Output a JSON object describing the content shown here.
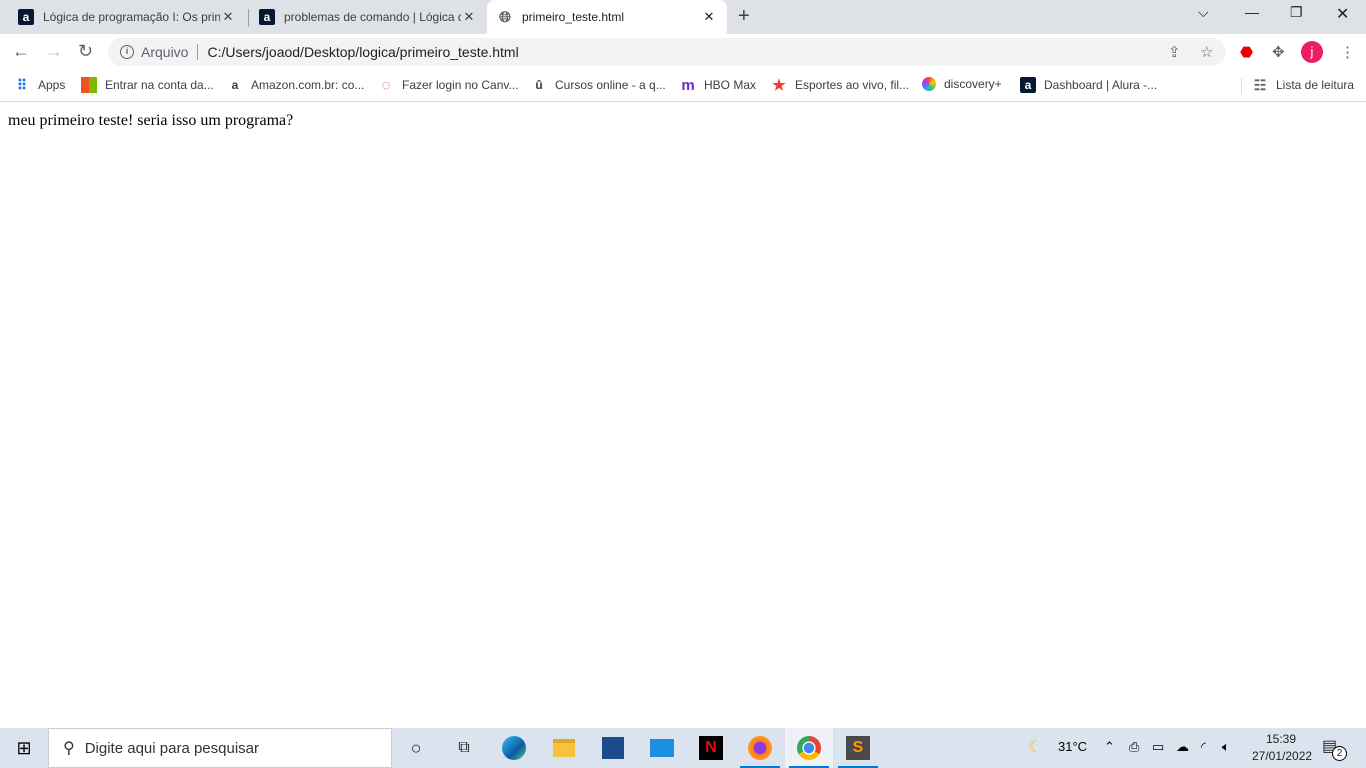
{
  "tabs": [
    {
      "title": "Lógica de programação I: Os prin",
      "favicon": "alura-icon"
    },
    {
      "title": "problemas de comando | Lógica d",
      "favicon": "alura-icon"
    },
    {
      "title": "primeiro_teste.html",
      "favicon": "globe-icon",
      "active": true
    }
  ],
  "address": {
    "scheme": "Arquivo",
    "url": "C:/Users/joaod/Desktop/logica/primeiro_teste.html"
  },
  "bookmarks": [
    {
      "label": "Apps"
    },
    {
      "label": "Entrar na conta da..."
    },
    {
      "label": "Amazon.com.br: co..."
    },
    {
      "label": "Fazer login no Canv..."
    },
    {
      "label": "Cursos online - a q..."
    },
    {
      "label": "HBO Max"
    },
    {
      "label": "Esportes ao vivo, fil..."
    },
    {
      "label": "discovery+"
    },
    {
      "label": "Dashboard | Alura -..."
    }
  ],
  "reading_list": "Lista de leitura",
  "profile_initial": "j",
  "page": {
    "text": "meu primeiro teste! seria isso um programa?"
  },
  "taskbar": {
    "search_placeholder": "Digite aqui para pesquisar",
    "temperature": "31°C",
    "time": "15:39",
    "date": "27/01/2022",
    "notifications": "2"
  },
  "colors": {
    "tabbar": "#dee1e6",
    "taskbar": "#dbe4ee",
    "accent": "#0078d7",
    "profile": "#e91e63"
  }
}
